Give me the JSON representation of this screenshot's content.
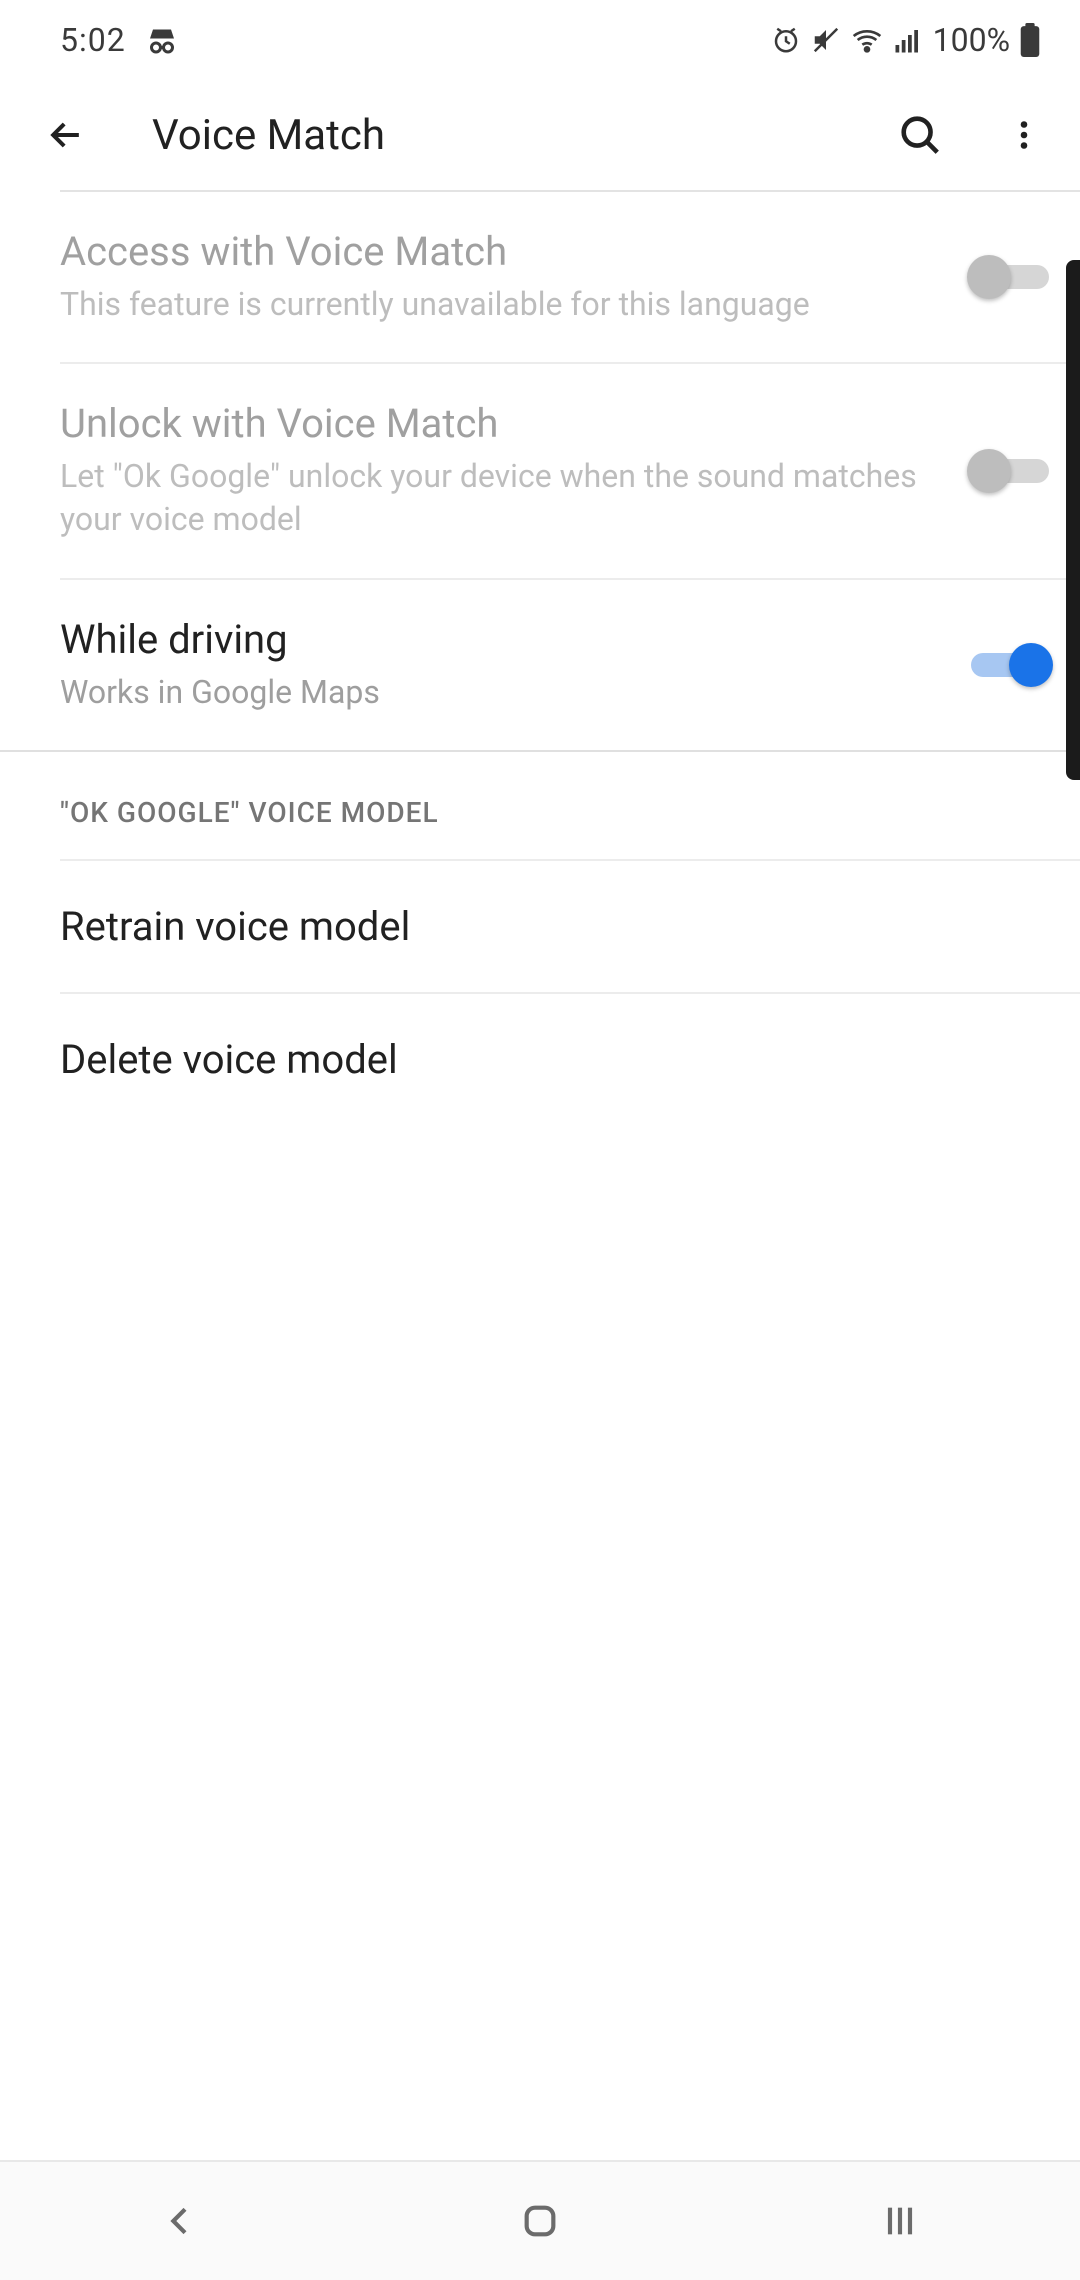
{
  "status_bar": {
    "time": "5:02",
    "battery_pct": "100%"
  },
  "app_bar": {
    "title": "Voice Match"
  },
  "settings": [
    {
      "title": "Access with Voice Match",
      "subtitle": "This feature is currently unavailable for this language",
      "toggle_on": false,
      "disabled": true
    },
    {
      "title": "Unlock with Voice Match",
      "subtitle": "Let \"Ok Google\" unlock your device when the sound matches your voice model",
      "toggle_on": false,
      "disabled": true
    },
    {
      "title": "While driving",
      "subtitle": "Works in Google Maps",
      "toggle_on": true,
      "disabled": false
    }
  ],
  "section": {
    "label": "\"OK GOOGLE\" VOICE MODEL",
    "items": [
      {
        "title": "Retrain voice model"
      },
      {
        "title": "Delete voice model"
      }
    ]
  },
  "colors": {
    "accent": "#1a73e8"
  }
}
